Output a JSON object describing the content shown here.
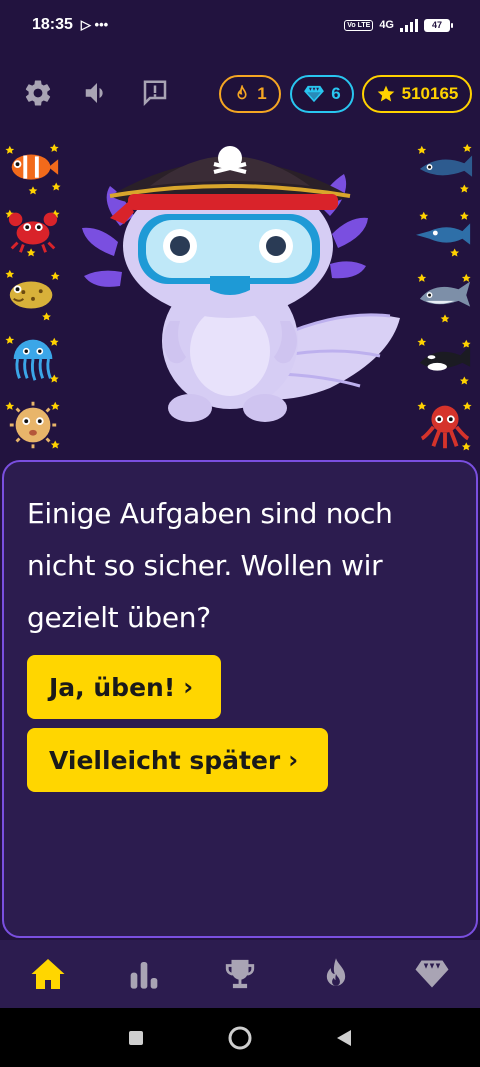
{
  "status_bar": {
    "time": "18:35",
    "extra": "▷ •••",
    "network": "4G",
    "volte": "Vo LTE",
    "battery": "47"
  },
  "toolbar": {
    "streak_count": "1",
    "gems_count": "6",
    "stars_count": "510165"
  },
  "colors": {
    "background": "#22133f",
    "card": "#2c1c4f",
    "card_border": "#7a4fe0",
    "accent_yellow": "#ffd600",
    "streak_orange": "#f5a623",
    "gem_cyan": "#29c6f0"
  },
  "hero": {
    "left_stickers": [
      "clownfish-sticker",
      "crab-sticker",
      "pufferfish-sticker",
      "jellyfish-sticker",
      "blowfish-sticker"
    ],
    "right_stickers": [
      "shark-sticker",
      "swordfish-sticker",
      "dolphin-sticker",
      "orca-sticker",
      "octopus-sticker"
    ]
  },
  "dialog": {
    "message": "Einige Aufgaben sind noch nicht so sicher. Wollen wir gezielt üben?",
    "primary_button": "Ja, üben!",
    "secondary_button": "Vielleicht später",
    "arrow": "›"
  },
  "bottom_nav": {
    "items": [
      "home-icon",
      "stats-icon",
      "trophy-icon",
      "flame-icon",
      "gem-icon"
    ],
    "active": "home-icon"
  }
}
